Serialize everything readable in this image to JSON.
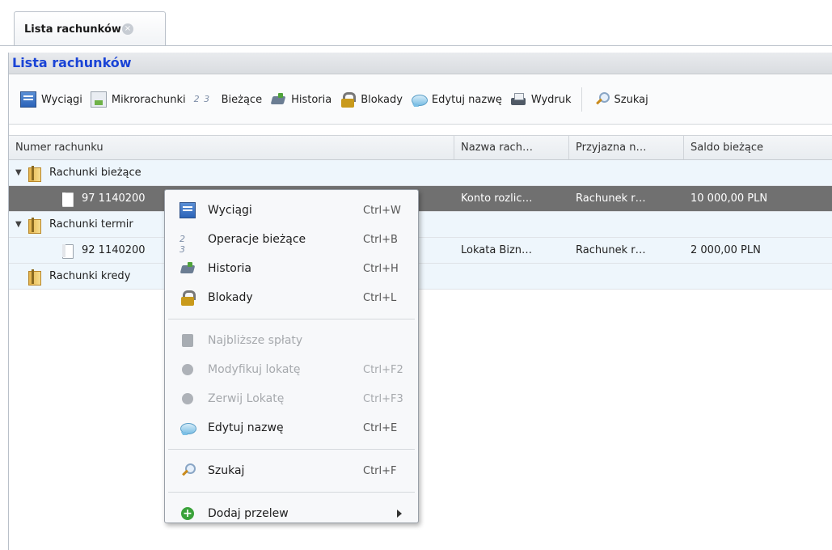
{
  "tab": {
    "label": "Lista rachunków",
    "close_glyph": "×"
  },
  "panel": {
    "title": "Lista rachunków"
  },
  "toolbar": {
    "items": [
      {
        "label": "Wyciągi",
        "icon": "statement-icon"
      },
      {
        "label": "Mikrorachunki",
        "icon": "micro-accounts-icon"
      },
      {
        "label": "Bieżące",
        "icon": "current-operations-icon"
      },
      {
        "label": "Historia",
        "icon": "history-icon"
      },
      {
        "label": "Blokady",
        "icon": "lock-icon"
      },
      {
        "label": "Edytuj nazwę",
        "icon": "speech-bubble-icon"
      },
      {
        "label": "Wydruk",
        "icon": "printer-icon"
      },
      {
        "label": "Szukaj",
        "icon": "search-icon"
      }
    ]
  },
  "grid": {
    "columns": [
      "Numer rachunku",
      "Nazwa rach…",
      "Przyjazna n…",
      "Saldo bieżące"
    ],
    "rows": [
      {
        "level": 0,
        "expanded": true,
        "type": "group",
        "name": "Rachunki bieżące"
      },
      {
        "level": 1,
        "type": "account",
        "selected": true,
        "number": "97 1140200",
        "name": "Konto rozlic…",
        "friendly": "Rachunek r…",
        "balance": "10 000,00 PLN"
      },
      {
        "level": 0,
        "expanded": true,
        "type": "group",
        "name": "Rachunki termir"
      },
      {
        "level": 1,
        "type": "account",
        "selected": false,
        "number": "92 1140200",
        "name": "Lokata Bizn…",
        "friendly": "Rachunek r…",
        "balance": "2 000,00 PLN"
      },
      {
        "level": 0,
        "expanded": false,
        "type": "group",
        "name": "Rachunki kredy"
      }
    ]
  },
  "context_menu": {
    "items": [
      {
        "label": "Wyciągi",
        "shortcut": "Ctrl+W",
        "enabled": true
      },
      {
        "label": "Operacje bieżące",
        "shortcut": "Ctrl+B",
        "enabled": true
      },
      {
        "label": "Historia",
        "shortcut": "Ctrl+H",
        "enabled": true
      },
      {
        "label": "Blokady",
        "shortcut": "Ctrl+L",
        "enabled": true
      },
      {
        "label": "Najbliższe spłaty",
        "shortcut": "",
        "enabled": false
      },
      {
        "label": "Modyfikuj lokatę",
        "shortcut": "Ctrl+F2",
        "enabled": false
      },
      {
        "label": "Zerwij Lokatę",
        "shortcut": "Ctrl+F3",
        "enabled": false
      },
      {
        "label": "Edytuj nazwę",
        "shortcut": "Ctrl+E",
        "enabled": true
      },
      {
        "label": "Szukaj",
        "shortcut": "Ctrl+F",
        "enabled": true
      },
      {
        "label": "Dodaj przelew",
        "shortcut": "",
        "enabled": true,
        "submenu": true
      }
    ]
  }
}
